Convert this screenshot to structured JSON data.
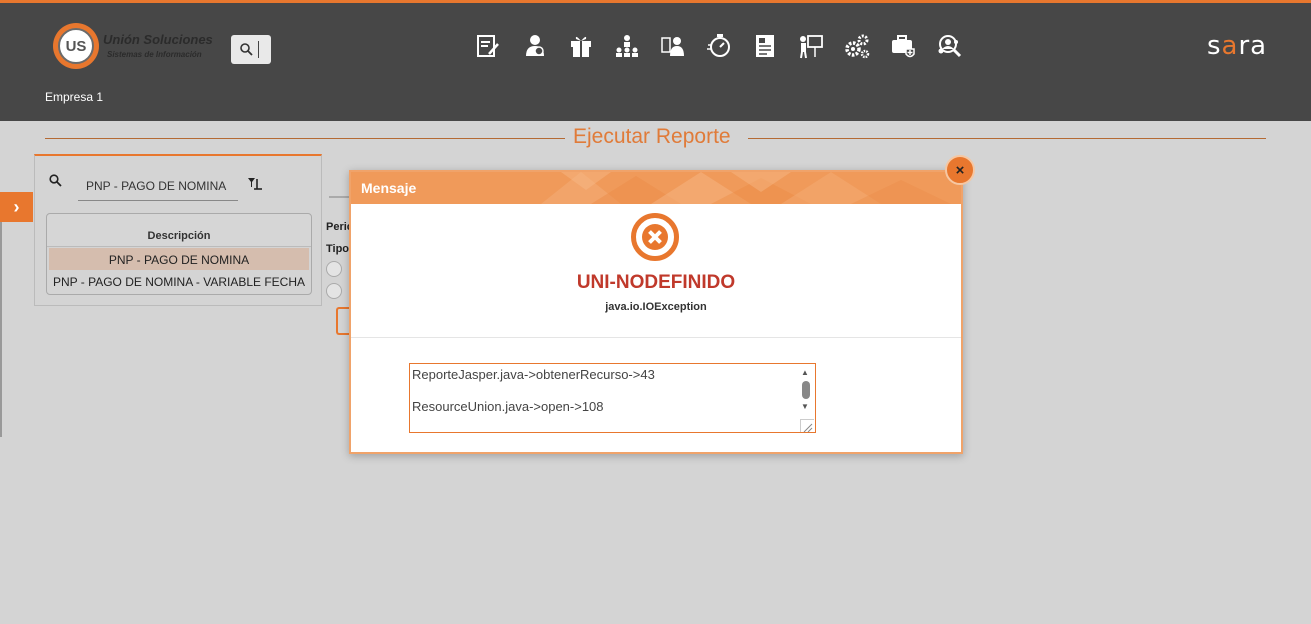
{
  "header": {
    "logo_line1": "Unión Soluciones",
    "logo_line2": "Sistemas de Información",
    "logo_mark": "US",
    "company": "Empresa 1",
    "brand": "sara",
    "nav_icons": [
      "document-edit-icon",
      "user-money-icon",
      "gift-icon",
      "org-chart-icon",
      "user-badge-icon",
      "timer-icon",
      "id-card-icon",
      "presentation-icon",
      "gears-icon",
      "medical-briefcase-icon",
      "user-search-icon"
    ]
  },
  "page": {
    "title": "Ejecutar Reporte"
  },
  "left_panel": {
    "search_value": "PNP - PAGO DE NOMINA",
    "table_header": "Descripción",
    "rows": [
      "PNP - PAGO DE NOMINA",
      "PNP - PAGO DE NOMINA - VARIABLE FECHA"
    ]
  },
  "right_panel": {
    "label_periodo": "Peric",
    "label_tipo": "Tipo"
  },
  "modal": {
    "title": "Mensaje",
    "error_code": "UNI-NODEFINIDO",
    "error_type": "java.io.IOException",
    "detail_lines": [
      "ReporteJasper.java->obtenerRecurso->43",
      "ResourceUnion.java->open->108"
    ],
    "close_symbol": "×"
  },
  "colors": {
    "accent": "#e8772e",
    "header_bg": "#474747",
    "error": "#c0392b"
  }
}
